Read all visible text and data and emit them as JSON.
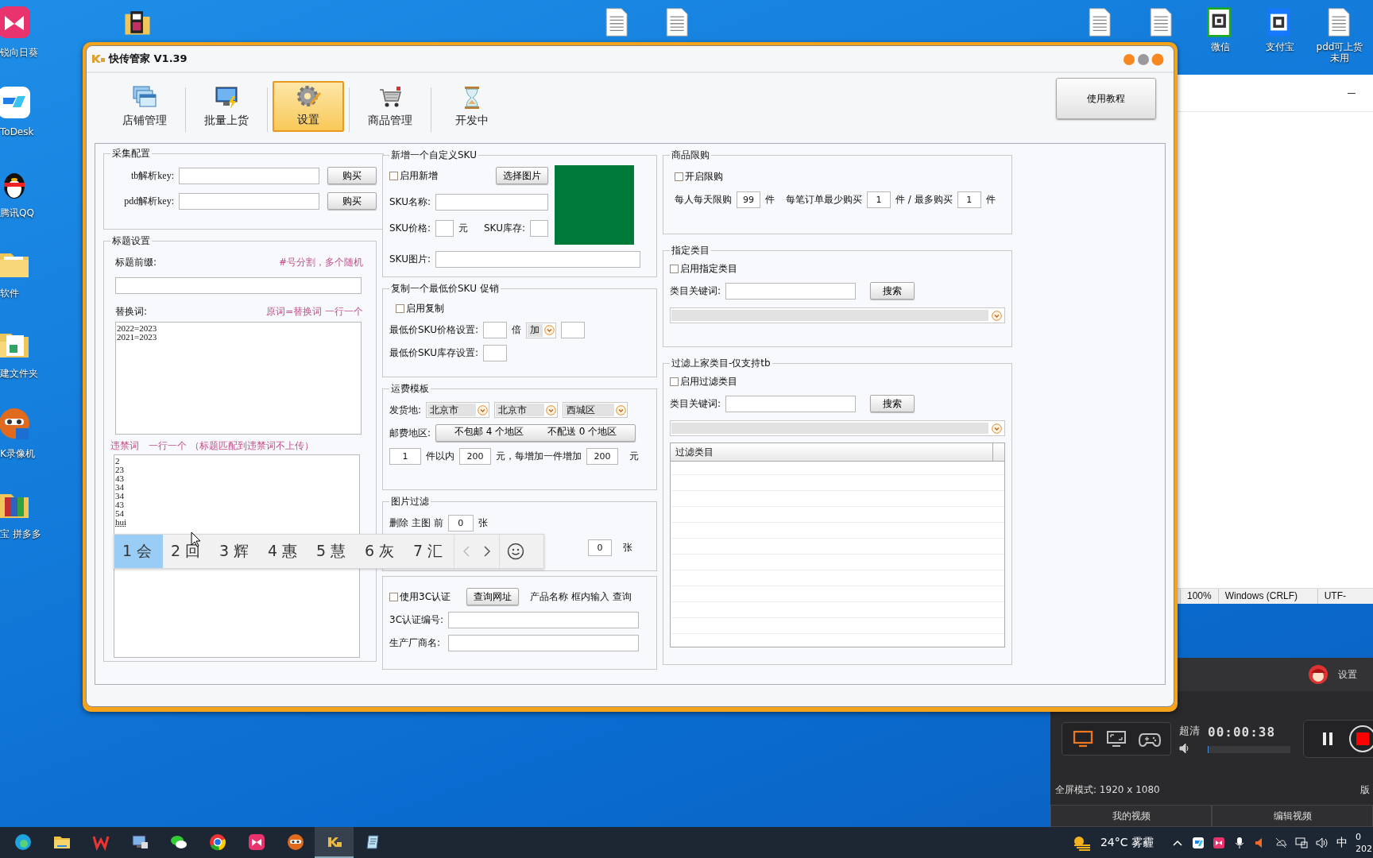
{
  "desktop": {
    "left_icons": [
      {
        "kind": "sunflower",
        "label": "锐向日葵"
      },
      {
        "kind": "todesk",
        "label": "ToDesk"
      },
      {
        "kind": "penguin",
        "label": "腾讯QQ"
      },
      {
        "kind": "folder",
        "label": "软件"
      },
      {
        "kind": "sheet-folder",
        "label": "建文件夹"
      },
      {
        "kind": "recorder",
        "label": "K录像机"
      },
      {
        "kind": "archive",
        "label": "宝 拼多多"
      }
    ],
    "top_icons": [
      {
        "kind": "film"
      },
      {
        "kind": "document"
      },
      {
        "kind": "document"
      },
      {
        "kind": "document"
      },
      {
        "kind": "document"
      },
      {
        "kind": "qr-green",
        "label": "微信"
      },
      {
        "kind": "qr-blue",
        "label": "支付宝"
      },
      {
        "kind": "document",
        "label": "pdd可上货未用"
      }
    ]
  },
  "notepad": {
    "status": [
      "100%",
      "Windows (CRLF)",
      "UTF-"
    ]
  },
  "recorder": {
    "volume": {
      "level": 0
    },
    "settings": "设置",
    "quality": "超清",
    "timer": "00:00:38",
    "mode_text": "全屏模式: 1920 x 1080",
    "edge_text": "版",
    "buttons": [
      "我的视频",
      "编辑视频"
    ],
    "modes": [
      {
        "kind": "screen",
        "selected": true
      },
      {
        "kind": "region",
        "selected": false
      },
      {
        "kind": "game",
        "selected": false
      }
    ]
  },
  "app": {
    "title": "快传管家 V1.39",
    "toolbar": [
      {
        "kind": "windows",
        "label": "店铺管理",
        "selected": false
      },
      {
        "kind": "monitor",
        "label": "批量上货",
        "selected": false
      },
      {
        "kind": "gear",
        "label": "设置",
        "selected": true
      },
      {
        "kind": "cart",
        "label": "商品管理",
        "selected": false
      },
      {
        "kind": "hourglass",
        "label": "开发中",
        "selected": false
      }
    ],
    "help_button": "使用教程",
    "collect": {
      "title": "采集配置",
      "keys": [
        {
          "label": "tb解析key:",
          "button": "购买"
        },
        {
          "label": "pdd解析key:",
          "button": "购买"
        }
      ]
    },
    "title_settings": {
      "title": "标题设置",
      "prefix_label": "标题前缀:",
      "prefix_hint": "#号分割，多个随机",
      "replace_label": "替换词:",
      "replace_hint": "原词=替换词 一行一个",
      "replace_lines": [
        "2022=2023",
        "2021=2023"
      ],
      "banned_label": "违禁词　一行一个 （标题匹配到违禁词不上传）",
      "banned_lines": [
        "2",
        "23",
        "43",
        "34",
        "34",
        "43",
        "54"
      ],
      "banned_composing": "hui"
    },
    "custom_sku": {
      "title": "新增一个自定义SKU",
      "enable": {
        "label": "启用新增",
        "checked": false
      },
      "choose_button": "选择图片",
      "name_label": "SKU名称:",
      "price_label": "SKU价格:",
      "price_unit": "元",
      "stock_label": "SKU库存:",
      "image_label": "SKU图片:"
    },
    "copy_sku": {
      "title": "复制一个最低价SKU 促销",
      "enable": {
        "label": "启用复制",
        "checked": false
      },
      "price_label": "最低价SKU价格设置:",
      "times_unit": "倍",
      "operator": "加",
      "stock_label": "最低价SKU库存设置:"
    },
    "shipping": {
      "title": "运费模板",
      "origin_label": "发货地:",
      "origin": [
        "北京市",
        "北京市",
        "西城区"
      ],
      "region_label": "邮费地区:",
      "region_parts": [
        "不包邮 4 个地区",
        "不配送 0 个地区"
      ],
      "count": "1",
      "count_unit": "件以内",
      "first_fee": "200",
      "extra_label": "元，每增加一件增加",
      "extra_fee": "200",
      "fee_unit": "元"
    },
    "image_filter": {
      "title": "图片过滤",
      "row_label": "删除 主图 前",
      "value": "0",
      "unit": "张",
      "second_value": "0",
      "second_unit": "张"
    },
    "cert": {
      "enable": {
        "label": "使用3C认证",
        "checked": false
      },
      "query_button": "查询网址",
      "note": "产品名称 框内输入 查询",
      "number_label": "3C认证编号:",
      "maker_label": "生产厂商名:"
    },
    "limit": {
      "title": "商品限购",
      "enable": {
        "label": "开启限购",
        "checked": false
      },
      "per_day_label": "每人每天限购",
      "per_day": "99",
      "unit": "件",
      "min_label": "每笔订单最少购买",
      "min": "1",
      "max_label": "件 / 最多购买",
      "max": "1",
      "max_unit": "件"
    },
    "category": {
      "title": "指定类目",
      "enable": {
        "label": "启用指定类目",
        "checked": false
      },
      "keyword_label": "类目关键词:",
      "search_button": "搜索"
    },
    "filter": {
      "title": "过滤上家类目-仅支持tb",
      "enable": {
        "label": "启用过滤类目",
        "checked": false
      },
      "keyword_label": "类目关键词:",
      "search_button": "搜索",
      "column": "过滤类目"
    }
  },
  "ime": {
    "candidates": [
      {
        "label": "1 会",
        "selected": true
      },
      {
        "label": "2 回",
        "selected": false
      },
      {
        "label": "3 辉",
        "selected": false
      },
      {
        "label": "4 惠",
        "selected": false
      },
      {
        "label": "5 慧",
        "selected": false
      },
      {
        "label": "6 灰",
        "selected": false
      },
      {
        "label": "7 汇",
        "selected": false
      }
    ]
  },
  "taskbar": {
    "apps": [
      {
        "kind": "edge",
        "active": false
      },
      {
        "kind": "folder",
        "active": false
      },
      {
        "kind": "wps",
        "active": false
      },
      {
        "kind": "computer",
        "active": false
      },
      {
        "kind": "chat",
        "active": false
      },
      {
        "kind": "chrome",
        "active": false
      },
      {
        "kind": "sunflower",
        "active": false
      },
      {
        "kind": "recorder",
        "active": false
      },
      {
        "kind": "ks",
        "active": true
      },
      {
        "kind": "notepad",
        "active": false
      }
    ],
    "weather": "24°C 雾霾",
    "input_method": "中",
    "clock": [
      "0",
      "202"
    ]
  }
}
